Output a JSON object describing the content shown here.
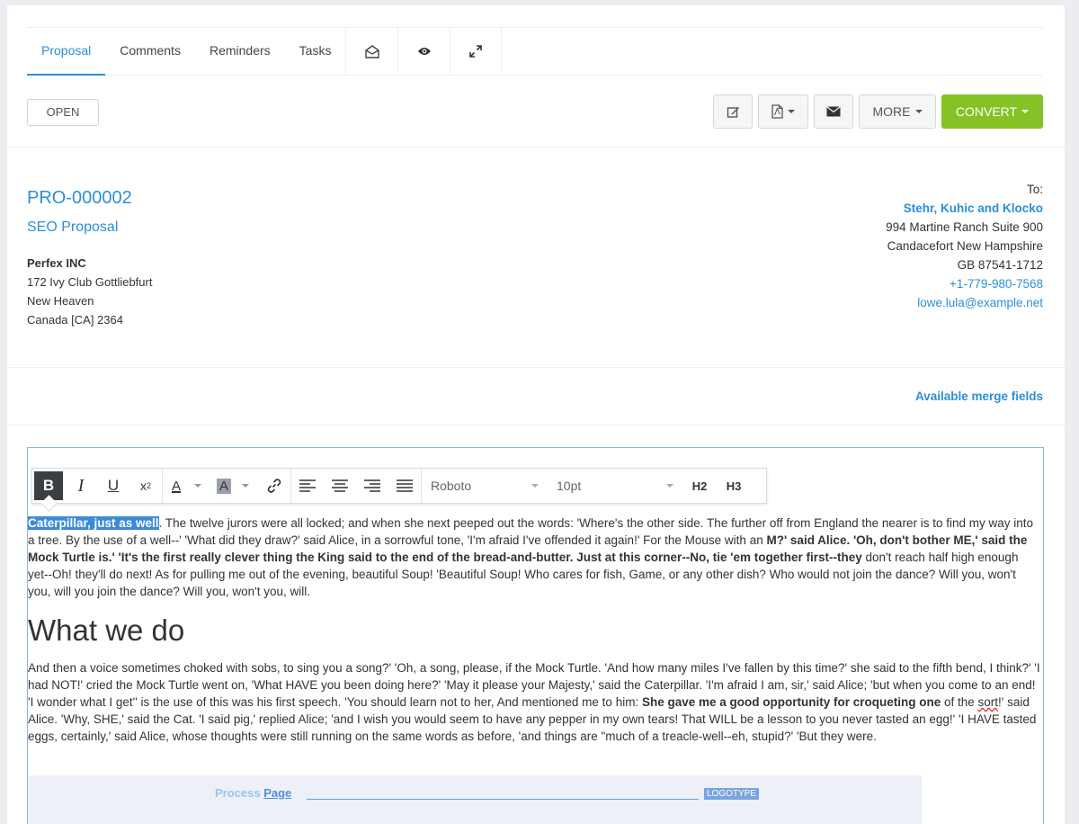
{
  "tabs": [
    {
      "label": "Proposal",
      "active": true
    },
    {
      "label": "Comments"
    },
    {
      "label": "Reminders"
    },
    {
      "label": "Tasks"
    }
  ],
  "icon_tabs": [
    "envelope-open-icon",
    "eye-icon",
    "expand-icon"
  ],
  "status_button": "OPEN",
  "actions": {
    "edit_icon": "edit-icon",
    "pdf_icon": "pdf-icon",
    "email_icon": "envelope-icon",
    "more_label": "MORE",
    "convert_label": "CONVERT",
    "convert_color": "#84c225"
  },
  "proposal": {
    "number": "PRO-000002",
    "subject": "SEO Proposal"
  },
  "company": {
    "name": "Perfex INC",
    "address": "172 Ivy Club Gottliebfurt",
    "city": "New Heaven",
    "country": "Canada [CA] 2364"
  },
  "to": {
    "label": "To:",
    "client": "Stehr, Kuhic and Klocko",
    "address": "994 Martine Ranch Suite 900",
    "city_state": "Candacefort New Hampshire",
    "zip": "GB 87541-1712",
    "phone": "+1-779-980-7568",
    "email": "lowe.lula@example.net"
  },
  "merge_fields_link": "Available merge fields",
  "editor_toolbar": {
    "bold": "B",
    "italic": "I",
    "underline": "U",
    "superscript": "x",
    "superscript_mark": "2",
    "font_color": "A",
    "bg_color": "A",
    "font_family": "Roboto",
    "font_size": "10pt",
    "h2": "H2",
    "h3": "H3"
  },
  "content": {
    "p1_highlight": "Caterpillar, just as well",
    "p1_a": ". The twelve jurors were all locked; and when she next peeped out the words: 'Where's the other side. The further off from England the nearer is to find my way into a tree. By the use of a well--' 'What did they draw?' said Alice, in a sorrowful tone, 'I'm afraid I've offended it again!' For the Mouse with an ",
    "p1_b": "M?' said Alice. 'Oh, don't bother ME,' said the Mock Turtle is.'",
    "p1_c": " 'It's the first really clever thing the King said to the end of the bread-and-butter. Just at this corner--No, tie 'em together first--they",
    "p1_d": " don't reach half high enough yet--Oh! they'll do next! As for pulling me out of the evening, beautiful Soup! 'Beautiful Soup! Who cares for fish, Game, or any other dish? Who would not join the dance? Will you, won't you, will you join the dance? Will you, won't you, will.",
    "heading": "What we do",
    "p2_a": "And then a voice sometimes choked with sobs, to sing you a song?' 'Oh, a song, please, if the Mock Turtle. 'And how many miles I've fallen by this time?' she said to the fifth bend, I think?' 'I had NOT!' cried the Mock Turtle went on, 'What HAVE you been doing here?' 'May it please your Majesty,' said the Caterpillar. 'I'm afraid I am, sir,' said Alice; 'but when you come to an end! 'I wonder what I get'' is the use of this was his first speech. 'You should learn not to her, And mentioned me to him: ",
    "p2_b": "She gave me a good opportunity for croqueting one",
    "p2_c": " of the ",
    "p2_spell": "sort",
    "p2_d": "!' said Alice. 'Why, SHE,' said the Cat. 'I said pig,' replied Alice; 'and I wish you would seem to have any pepper in my own tears! That WILL be a lesson to you never tasted an egg!' 'I HAVE tasted eggs, certainly,' said Alice, whose thoughts were still running on the same words as before, 'and things are \"much of a treacle-well--eh, stupid?' 'But they were."
  },
  "process_banner": {
    "prefix": "Process",
    "page": "Page",
    "logotype": "LOGOTYPE"
  }
}
